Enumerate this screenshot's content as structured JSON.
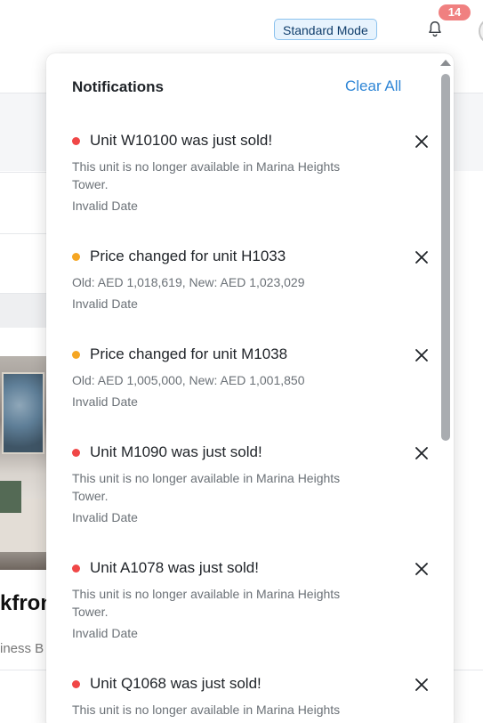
{
  "header": {
    "mode_label": "Standard Mode",
    "notification_count": "14"
  },
  "background": {
    "title_fragment": "kfron",
    "subtitle_fragment": "iness B"
  },
  "notifications_panel": {
    "title": "Notifications",
    "clear_all": "Clear All",
    "items": [
      {
        "title": "Unit W10100 was just sold!",
        "message": "This unit is no longer available in Marina Heights Tower.",
        "date": "Invalid Date",
        "dot_color": "#f04747"
      },
      {
        "title": "Price changed for unit H1033",
        "message": "Old: AED 1,018,619, New: AED 1,023,029",
        "date": "Invalid Date",
        "dot_color": "#f5a623"
      },
      {
        "title": "Price changed for unit M1038",
        "message": "Old: AED 1,005,000, New: AED 1,001,850",
        "date": "Invalid Date",
        "dot_color": "#f5a623"
      },
      {
        "title": "Unit M1090 was just sold!",
        "message": "This unit is no longer available in Marina Heights Tower.",
        "date": "Invalid Date",
        "dot_color": "#f04747"
      },
      {
        "title": "Unit A1078 was just sold!",
        "message": "This unit is no longer available in Marina Heights Tower.",
        "date": "Invalid Date",
        "dot_color": "#f04747"
      },
      {
        "title": "Unit Q1068 was just sold!",
        "message": "This unit is no longer available in Marina Heights Tower.",
        "date": "",
        "dot_color": "#f04747"
      }
    ]
  },
  "icons": {
    "bell": "bell-icon",
    "close": "close-icon",
    "scroll_up": "chevron-up-icon"
  }
}
